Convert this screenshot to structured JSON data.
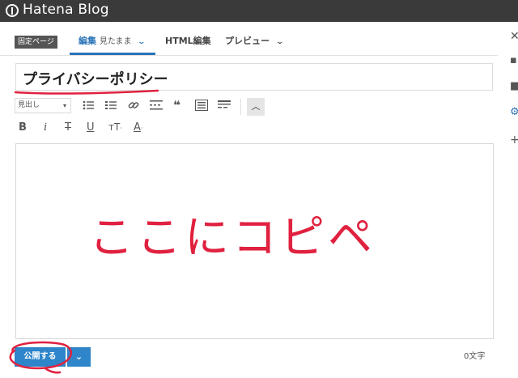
{
  "app": {
    "logo_text": "Hatena Blog"
  },
  "tabs": {
    "page_badge": "固定ページ",
    "edit_label": "編集",
    "edit_mode": "見たまま",
    "html_label": "HTML編集",
    "preview_label": "プレビュー"
  },
  "title": {
    "value": "プライバシーポリシー"
  },
  "toolbar": {
    "format_select": "見出し",
    "bold": "B",
    "italic": "i",
    "strike": "T",
    "underline": "U",
    "font_size": "тT",
    "font_color": "A"
  },
  "editor": {
    "overlay_text": "ここにコピペ"
  },
  "footer": {
    "publish_label": "公開する",
    "char_count": "0文字"
  },
  "colors": {
    "accent": "#2e85c9",
    "annotation_red": "#e0213f",
    "topbar": "#3a3a3a"
  }
}
